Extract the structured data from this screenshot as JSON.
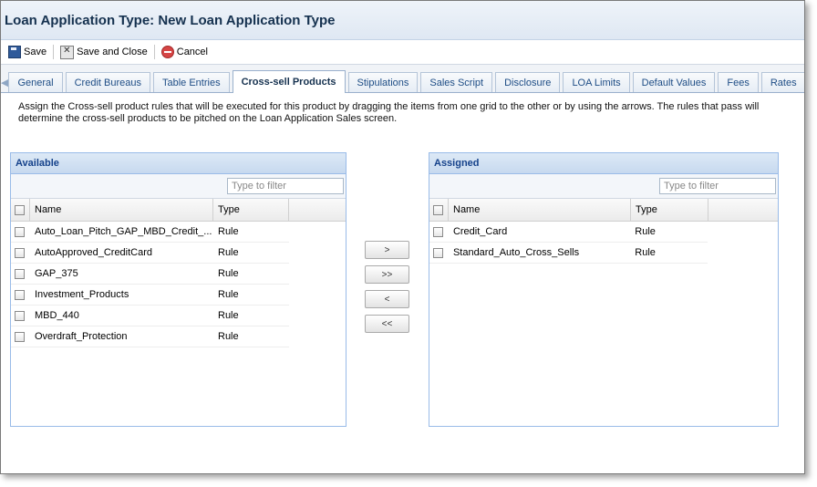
{
  "window": {
    "title": "Loan Application Type: New Loan Application Type"
  },
  "toolbar": {
    "save_label": "Save",
    "save_close_label": "Save and Close",
    "cancel_label": "Cancel"
  },
  "tabs": [
    {
      "label": "General"
    },
    {
      "label": "Credit Bureaus"
    },
    {
      "label": "Table Entries"
    },
    {
      "label": "Cross-sell Products",
      "active": true
    },
    {
      "label": "Stipulations"
    },
    {
      "label": "Sales Script"
    },
    {
      "label": "Disclosure"
    },
    {
      "label": "LOA Limits"
    },
    {
      "label": "Default Values"
    },
    {
      "label": "Fees"
    },
    {
      "label": "Rates"
    }
  ],
  "instructions": "Assign the Cross-sell product rules that will be executed for this product by dragging the items from one grid to the other or by using the arrows. The rules that pass will determine the cross-sell products to be pitched on the Loan Application Sales screen.",
  "available": {
    "title": "Available",
    "filter_placeholder": "Type to filter",
    "columns": {
      "name": "Name",
      "type": "Type"
    },
    "rows": [
      {
        "name": "Auto_Loan_Pitch_GAP_MBD_Credit_...",
        "type": "Rule"
      },
      {
        "name": "AutoApproved_CreditCard",
        "type": "Rule"
      },
      {
        "name": "GAP_375",
        "type": "Rule"
      },
      {
        "name": "Investment_Products",
        "type": "Rule"
      },
      {
        "name": "MBD_440",
        "type": "Rule"
      },
      {
        "name": "Overdraft_Protection",
        "type": "Rule"
      }
    ]
  },
  "assigned": {
    "title": "Assigned",
    "filter_placeholder": "Type to filter",
    "columns": {
      "name": "Name",
      "type": "Type"
    },
    "rows": [
      {
        "name": "Credit_Card",
        "type": "Rule"
      },
      {
        "name": "Standard_Auto_Cross_Sells",
        "type": "Rule"
      }
    ]
  },
  "move_buttons": {
    "add": ">",
    "add_all": ">>",
    "remove": "<",
    "remove_all": "<<"
  }
}
